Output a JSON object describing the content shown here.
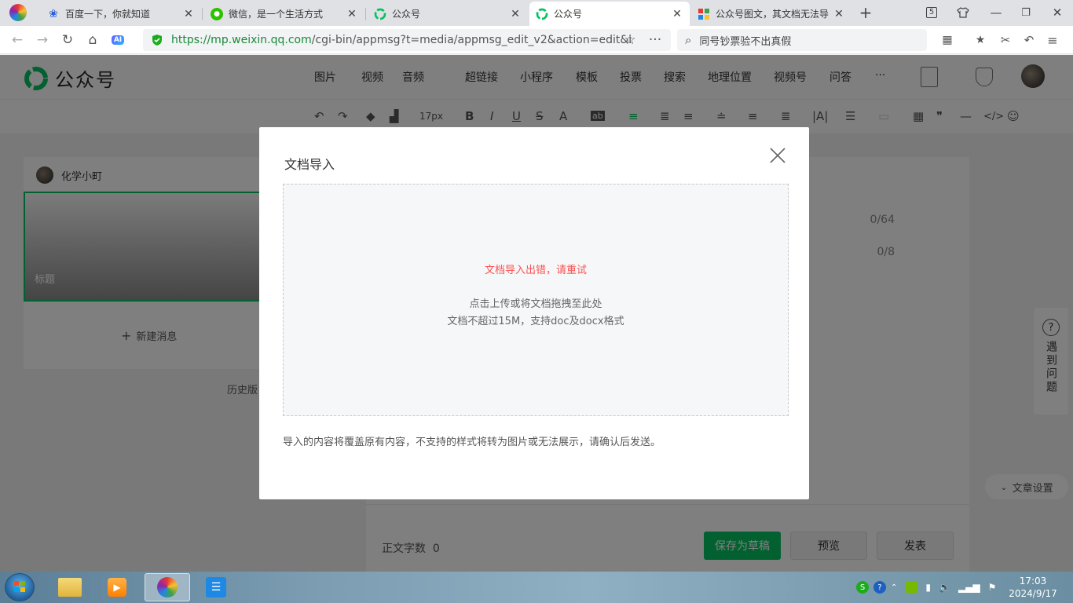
{
  "browser": {
    "tabs": [
      {
        "title": "百度一下，你就知道",
        "icon": "baidu-paw-icon"
      },
      {
        "title": "微信，是一个生活方式",
        "icon": "wechat-icon"
      },
      {
        "title": "公众号",
        "icon": "mp-logo-icon"
      },
      {
        "title": "公众号",
        "icon": "mp-logo-icon"
      },
      {
        "title": "公众号图文，其文档无法导",
        "icon": "grid-app-icon"
      }
    ],
    "tab_count_badge": "5",
    "url_main": "https://mp.weixin.qq.com",
    "url_rest": "/cgi-bin/appmsg?t=media/appmsg_edit_v2&action=edit&i",
    "search_text": "同号钞票验不出真假",
    "ai_badge": "AI"
  },
  "header": {
    "brand": "公众号",
    "menu": [
      "图片",
      "视频",
      "音频",
      "超链接",
      "小程序",
      "模板",
      "投票",
      "搜索",
      "地理位置",
      "视频号",
      "问答",
      "···"
    ]
  },
  "toolbar": {
    "font_size": "17px",
    "bold": "B",
    "italic": "I",
    "underline": "U",
    "strike": "S",
    "font_color": "A",
    "bg_color": "ab",
    "quote": "❞",
    "code": "</>"
  },
  "left": {
    "account_name": "化学小町",
    "cover_title": "标题",
    "new_message": "新建消息",
    "history": "历史版"
  },
  "editor": {
    "title_count": "0/64",
    "author_count": "0/8",
    "word_count_label": "正文字数",
    "word_count": "0",
    "save_draft": "保存为草稿",
    "preview": "预览",
    "publish": "发表",
    "article_settings": "文章设置",
    "help": "遇到问题"
  },
  "dialog": {
    "title": "文档导入",
    "error": "文档导入出错，请重试",
    "hint1": "点击上传或将文档拖拽至此处",
    "hint2": "文档不超过15M，支持doc及docx格式",
    "note": "导入的内容将覆盖原有内容，不支持的样式将转为图片或无法展示，请确认后发送。"
  },
  "taskbar": {
    "time": "17:03",
    "date": "2024/9/17"
  },
  "colors": {
    "brand_green": "#07c160",
    "error_red": "#fa5151"
  }
}
